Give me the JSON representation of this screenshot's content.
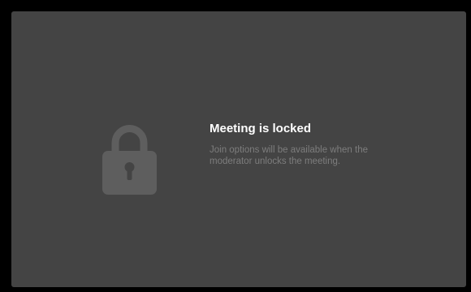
{
  "locked_screen": {
    "icon": "lock-icon",
    "title": "Meeting is locked",
    "description": "Join options will be available when the moderator unlocks the meeting."
  },
  "colors": {
    "frame": "#000000",
    "panel": "#444444",
    "icon": "#5e5e5e",
    "title": "#ffffff",
    "description": "#7d7d7d"
  }
}
